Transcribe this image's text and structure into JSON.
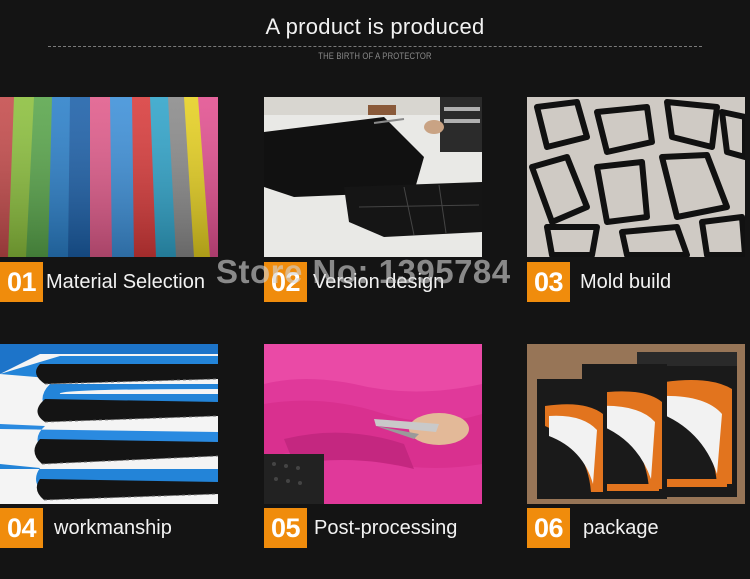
{
  "header": {
    "title": "A product is produced",
    "subtitle": "THE BIRTH OF A PROTECTOR"
  },
  "steps": [
    {
      "number": "01",
      "label": "Material Selection"
    },
    {
      "number": "02",
      "label": "Version design"
    },
    {
      "number": "03",
      "label": "Mold build"
    },
    {
      "number": "04",
      "label": "workmanship"
    },
    {
      "number": "05",
      "label": "Post-processing"
    },
    {
      "number": "06",
      "label": "package"
    }
  ],
  "watermark": "Store No: 1395784",
  "colors": {
    "background": "#141414",
    "number_badge": "#f08c0c",
    "text": "#f2f2f2"
  }
}
